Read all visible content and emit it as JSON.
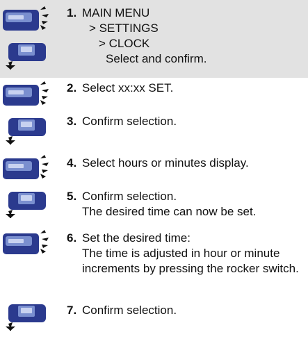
{
  "colors": {
    "band": "#e2e2e2",
    "device": "#2b3a8e",
    "device_light": "#7a8fcf",
    "text": "#111111"
  },
  "steps": [
    {
      "number": "1.",
      "lines": [
        "MAIN MENU",
        "> SETTINGS",
        "> CLOCK",
        "Select and confirm."
      ]
    },
    {
      "number": "2.",
      "text": "Select xx:xx SET."
    },
    {
      "number": "3.",
      "text": "Confirm selection."
    },
    {
      "number": "4.",
      "text": "Select hours or minutes display."
    },
    {
      "number": "5.",
      "lines": [
        "Confirm selection.",
        "The desired time can now be set."
      ]
    },
    {
      "number": "6.",
      "lines": [
        "Set the desired time:",
        "The time is adjusted in hour or minute increments by pressing the rocker switch."
      ]
    },
    {
      "number": "7.",
      "text": "Confirm selection."
    }
  ],
  "icons": [
    "rocker-switch-icon",
    "confirm-button-icon"
  ]
}
